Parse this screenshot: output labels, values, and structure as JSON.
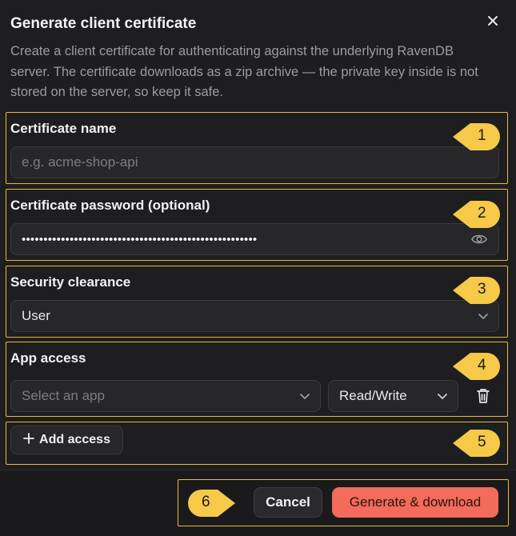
{
  "dialog": {
    "title": "Generate client certificate",
    "description": "Create a client certificate for authenticating against the underlying RavenDB server. The certificate downloads as a zip archive — the private key inside is not stored on the server, so keep it safe."
  },
  "fields": {
    "name": {
      "label": "Certificate name",
      "placeholder": "e.g. acme-shop-api"
    },
    "password": {
      "label": "Certificate password (optional)",
      "value": "••••••••••••••••••••••••••••••••••••••••••••••••••••••"
    },
    "clearance": {
      "label": "Security clearance",
      "value": "User"
    },
    "app_access": {
      "label": "App access",
      "app_placeholder": "Select an app",
      "permission": "Read/Write"
    }
  },
  "add_access_label": "Add access",
  "footer": {
    "cancel_label": "Cancel",
    "primary_label": "Generate & download"
  },
  "badges": [
    "1",
    "2",
    "3",
    "4",
    "5",
    "6"
  ],
  "colors": {
    "accent": "#f26b5b",
    "highlight": "#e8b93a",
    "badge": "#f7c948"
  },
  "icons": [
    "close-icon",
    "eye-icon",
    "chevron-down-icon",
    "trash-icon",
    "plus-icon"
  ]
}
